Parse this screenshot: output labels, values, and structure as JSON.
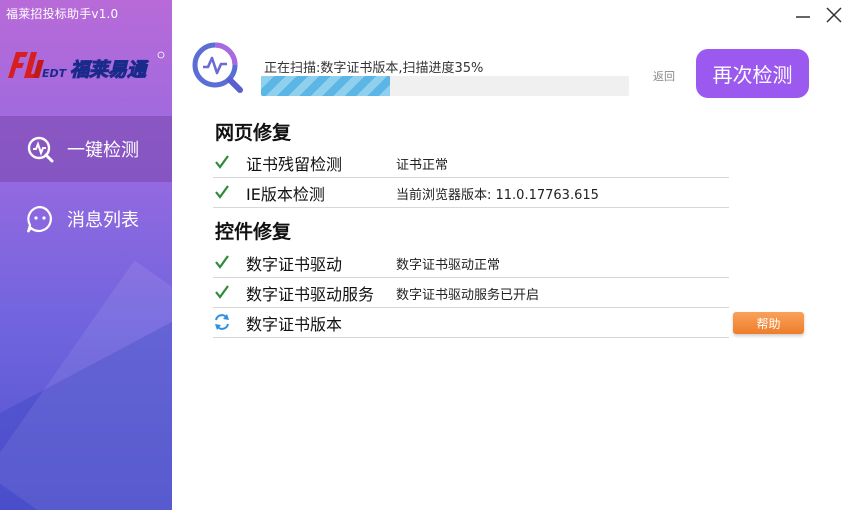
{
  "app": {
    "title": "福莱招投标助手v1.0",
    "logo_text_left": "EDT",
    "logo_text_cn": "福莱易通"
  },
  "sidebar": {
    "items": [
      {
        "label": "一键检测",
        "icon": "pulse-search-icon",
        "active": true
      },
      {
        "label": "消息列表",
        "icon": "message-bubble-icon",
        "active": false
      }
    ]
  },
  "window": {
    "minimize_icon": "minimize-icon",
    "close_icon": "close-icon"
  },
  "scan": {
    "status_text": "正在扫描:数字证书版本,扫描进度35%",
    "progress_fraction": 0.35,
    "back_label": "返回",
    "recheck_label": "再次检测"
  },
  "sections": [
    {
      "title": "网页修复",
      "rows": [
        {
          "status": "ok",
          "name": "证书残留检测",
          "result": "证书正常"
        },
        {
          "status": "ok",
          "name": "IE版本检测",
          "result": "当前浏览器版本: 11.0.17763.615"
        }
      ]
    },
    {
      "title": "控件修复",
      "rows": [
        {
          "status": "ok",
          "name": "数字证书驱动",
          "result": "数字证书驱动正常"
        },
        {
          "status": "ok",
          "name": "数字证书驱动服务",
          "result": "数字证书驱动服务已开启"
        },
        {
          "status": "scanning",
          "name": "数字证书版本",
          "result": ""
        }
      ]
    }
  ],
  "help_label": "帮助",
  "colors": {
    "accent_purple": "#9b59f0",
    "check_green": "#2e8b3a",
    "help_orange": "#ee7d2a",
    "progress_blue": "#5bb6e6"
  }
}
